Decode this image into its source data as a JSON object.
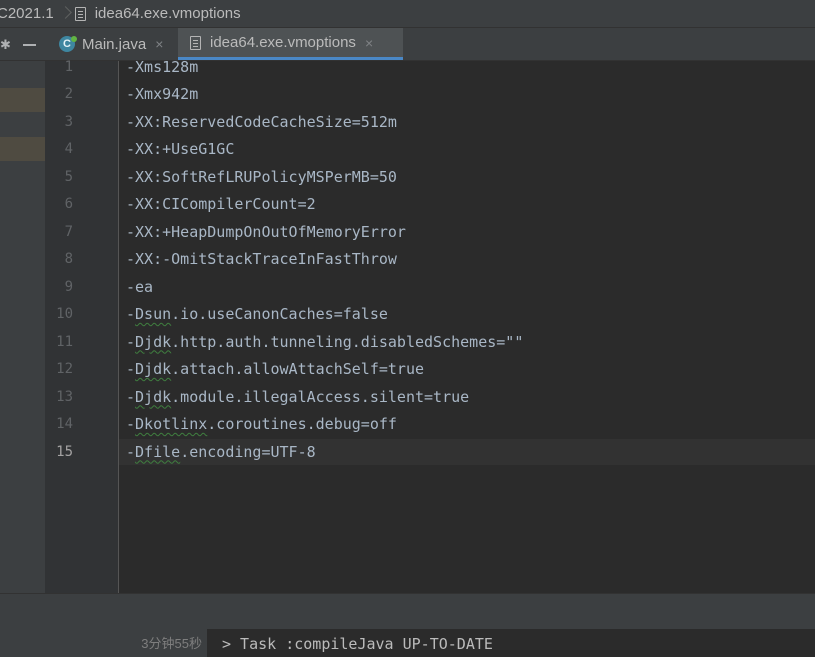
{
  "breadcrumb": {
    "project": "C2021.1",
    "file": "idea64.exe.vmoptions"
  },
  "tabs": [
    {
      "label": "Main.java",
      "icon": "java-class-icon",
      "active": false
    },
    {
      "label": "idea64.exe.vmoptions",
      "icon": "file-icon",
      "active": true
    }
  ],
  "editor": {
    "current_line": 15,
    "lines": [
      {
        "n": "1",
        "pre": "-Xms128m",
        "typo": "",
        "post": ""
      },
      {
        "n": "2",
        "pre": "-Xmx942m",
        "typo": "",
        "post": ""
      },
      {
        "n": "3",
        "pre": "-XX:ReservedCodeCacheSize=512m",
        "typo": "",
        "post": ""
      },
      {
        "n": "4",
        "pre": "-XX:+UseG1GC",
        "typo": "",
        "post": ""
      },
      {
        "n": "5",
        "pre": "-XX:SoftRefLRUPolicyMSPerMB=50",
        "typo": "",
        "post": ""
      },
      {
        "n": "6",
        "pre": "-XX:CICompilerCount=2",
        "typo": "",
        "post": ""
      },
      {
        "n": "7",
        "pre": "-XX:+HeapDumpOnOutOfMemoryError",
        "typo": "",
        "post": ""
      },
      {
        "n": "8",
        "pre": "-XX:-OmitStackTraceInFastThrow",
        "typo": "",
        "post": ""
      },
      {
        "n": "9",
        "pre": "-ea",
        "typo": "",
        "post": ""
      },
      {
        "n": "10",
        "pre": "-",
        "typo": "Dsun",
        "post": ".io.useCanonCaches=false"
      },
      {
        "n": "11",
        "pre": "-",
        "typo": "Djdk",
        "post": ".http.auth.tunneling.disabledSchemes=\"\""
      },
      {
        "n": "12",
        "pre": "-",
        "typo": "Djdk",
        "post": ".attach.allowAttachSelf=true"
      },
      {
        "n": "13",
        "pre": "-",
        "typo": "Djdk",
        "post": ".module.illegalAccess.silent=true"
      },
      {
        "n": "14",
        "pre": "-",
        "typo": "Dkotlinx",
        "post": ".coroutines.debug=off"
      },
      {
        "n": "15",
        "pre": "-",
        "typo": "Dfile",
        "post": ".encoding=UTF-8"
      }
    ]
  },
  "status": {
    "elapsed": "3分钟55秒",
    "console_line": "> Task :compileJava UP-TO-DATE"
  },
  "colors": {
    "accent": "#4a88c7",
    "background": "#2b2b2b",
    "panel": "#3c3f41"
  }
}
